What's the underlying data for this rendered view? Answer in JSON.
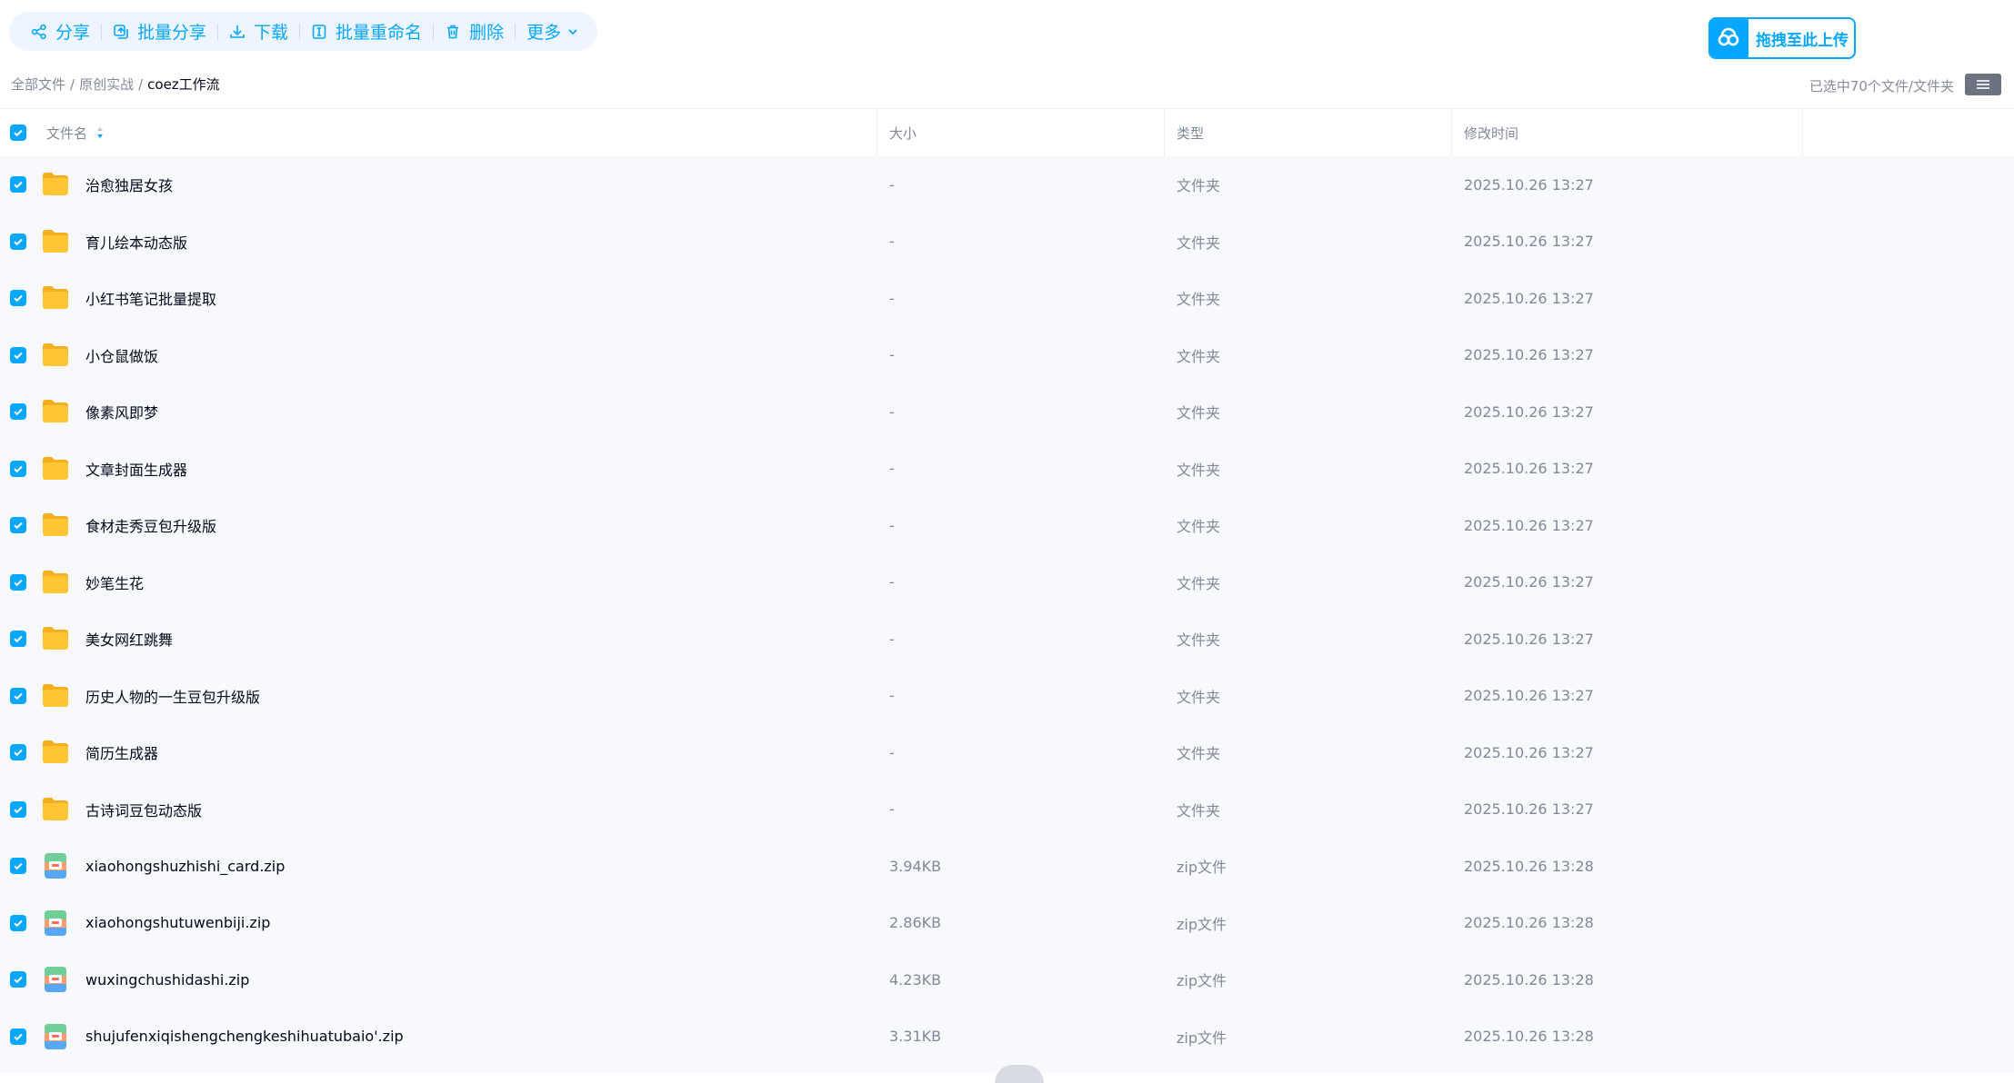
{
  "toolbar": {
    "share": "分享",
    "batch_share": "批量分享",
    "download": "下载",
    "batch_rename": "批量重命名",
    "delete": "删除",
    "more": "更多"
  },
  "upload": {
    "label": "拖拽至此上传"
  },
  "breadcrumb": [
    "全部文件",
    "原创实战",
    "coez工作流"
  ],
  "breadcrumb_sep": "/",
  "selection_info": "已选中70个文件/文件夹",
  "columns": {
    "name": "文件名",
    "size": "大小",
    "type": "类型",
    "modified": "修改时间"
  },
  "colors": {
    "accent": "#06a7ff",
    "folder": "#ffc533",
    "row_bg": "#f7f9fc"
  },
  "rows": [
    {
      "name": "治愈独居女孩",
      "size": "-",
      "type": "文件夹",
      "modified": "2025.10.26 13:27",
      "kind": "folder"
    },
    {
      "name": "育儿绘本动态版",
      "size": "-",
      "type": "文件夹",
      "modified": "2025.10.26 13:27",
      "kind": "folder"
    },
    {
      "name": "小红书笔记批量提取",
      "size": "-",
      "type": "文件夹",
      "modified": "2025.10.26 13:27",
      "kind": "folder"
    },
    {
      "name": "小仓鼠做饭",
      "size": "-",
      "type": "文件夹",
      "modified": "2025.10.26 13:27",
      "kind": "folder"
    },
    {
      "name": "像素风即梦",
      "size": "-",
      "type": "文件夹",
      "modified": "2025.10.26 13:27",
      "kind": "folder"
    },
    {
      "name": "文章封面生成器",
      "size": "-",
      "type": "文件夹",
      "modified": "2025.10.26 13:27",
      "kind": "folder"
    },
    {
      "name": "食材走秀豆包升级版",
      "size": "-",
      "type": "文件夹",
      "modified": "2025.10.26 13:27",
      "kind": "folder"
    },
    {
      "name": "妙笔生花",
      "size": "-",
      "type": "文件夹",
      "modified": "2025.10.26 13:27",
      "kind": "folder"
    },
    {
      "name": "美女网红跳舞",
      "size": "-",
      "type": "文件夹",
      "modified": "2025.10.26 13:27",
      "kind": "folder"
    },
    {
      "name": "历史人物的一生豆包升级版",
      "size": "-",
      "type": "文件夹",
      "modified": "2025.10.26 13:27",
      "kind": "folder"
    },
    {
      "name": "简历生成器",
      "size": "-",
      "type": "文件夹",
      "modified": "2025.10.26 13:27",
      "kind": "folder"
    },
    {
      "name": "古诗词豆包动态版",
      "size": "-",
      "type": "文件夹",
      "modified": "2025.10.26 13:27",
      "kind": "folder"
    },
    {
      "name": "xiaohongshuzhishi_card.zip",
      "size": "3.94KB",
      "type": "zip文件",
      "modified": "2025.10.26 13:28",
      "kind": "zip"
    },
    {
      "name": "xiaohongshutuwenbiji.zip",
      "size": "2.86KB",
      "type": "zip文件",
      "modified": "2025.10.26 13:28",
      "kind": "zip"
    },
    {
      "name": "wuxingchushidashi.zip",
      "size": "4.23KB",
      "type": "zip文件",
      "modified": "2025.10.26 13:28",
      "kind": "zip"
    },
    {
      "name": "shujufenxiqishengchengkeshihuatubaio'.zip",
      "size": "3.31KB",
      "type": "zip文件",
      "modified": "2025.10.26 13:28",
      "kind": "zip"
    }
  ]
}
